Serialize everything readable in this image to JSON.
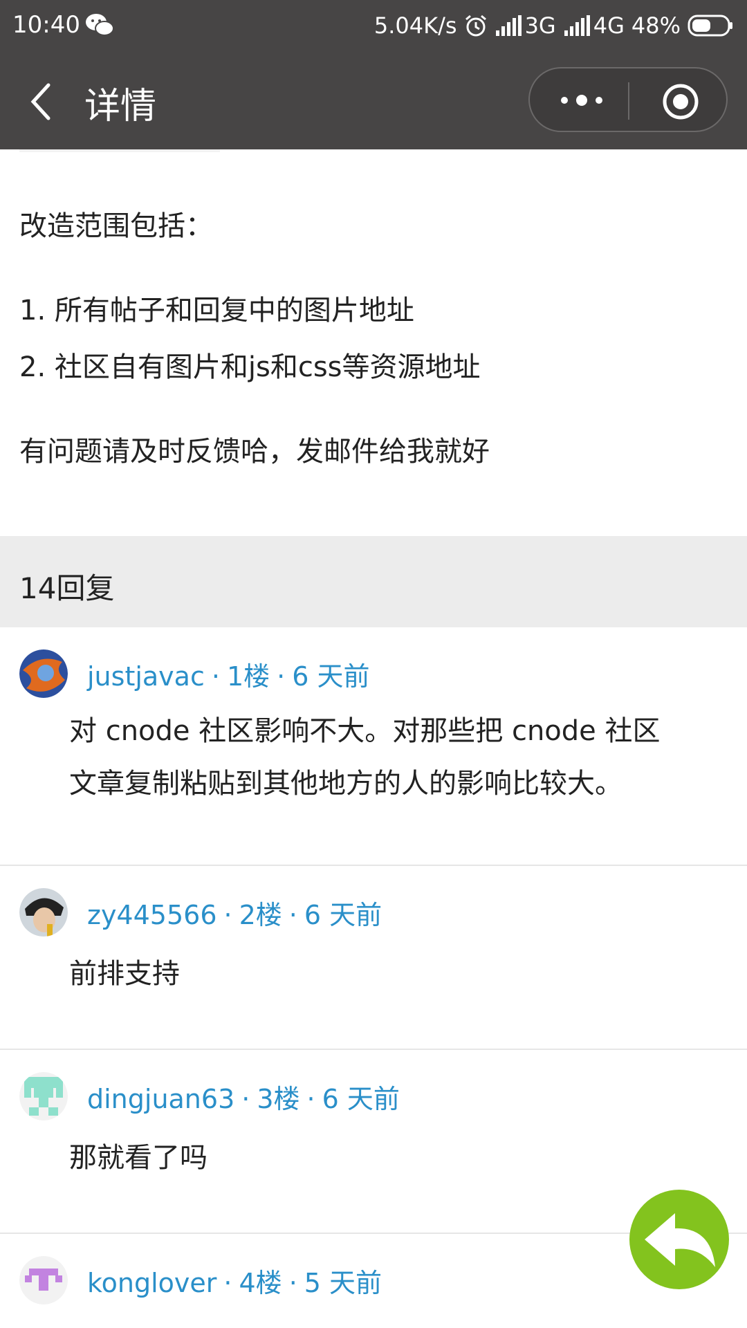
{
  "status_bar": {
    "time": "10:40",
    "net_speed": "5.04K/s",
    "network_1": "3G",
    "network_2": "4G",
    "battery": "48%"
  },
  "title_bar": {
    "title": "详情"
  },
  "article": {
    "scope_heading": "改造范围包括：",
    "items": [
      "1. 所有帖子和回复中的图片地址",
      "2. 社区自有图片和js和css等资源地址"
    ],
    "feedback": "有问题请及时反馈哈，发邮件给我就好"
  },
  "replies_header": {
    "count_label": "14回复"
  },
  "replies": [
    {
      "author": "justjavac",
      "floor": "1楼",
      "time": "6 天前",
      "text_lines": [
        "对 cnode 社区影响不大。对那些把 cnode 社区",
        "文章复制粘贴到其他地方的人的影响比较大。"
      ]
    },
    {
      "author": "zy445566",
      "floor": "2楼",
      "time": "6 天前",
      "text_lines": [
        "前排支持"
      ]
    },
    {
      "author": "dingjuan63",
      "floor": "3楼",
      "time": "6 天前",
      "text_lines": [
        "那就看了吗"
      ]
    },
    {
      "author": "konglover",
      "floor": "4楼",
      "time": "5 天前",
      "text_lines": []
    }
  ],
  "meta_separator": "·",
  "colors": {
    "header_bg": "#474545",
    "link_blue": "#2a8fc9",
    "fab_green": "#83c31e",
    "reply_header_bg": "#ececec"
  },
  "icons": {
    "status_bar": [
      "wechat-icon",
      "alarm-icon",
      "signal-icon",
      "battery-icon"
    ],
    "title_bar": [
      "back-icon",
      "more-icon",
      "target-icon"
    ],
    "fab": "reply-back-icon"
  }
}
